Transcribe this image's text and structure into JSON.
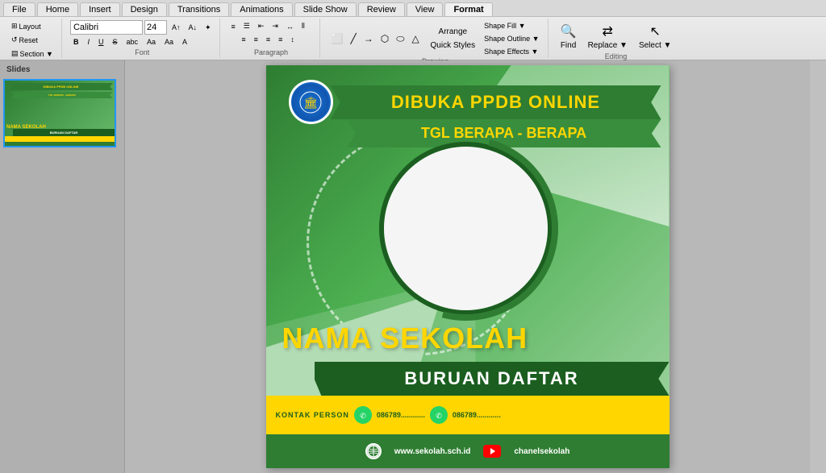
{
  "ribbon": {
    "tabs": [
      "File",
      "Home",
      "Insert",
      "Design",
      "Transitions",
      "Animations",
      "Slide Show",
      "Review",
      "View",
      "Format"
    ],
    "active_tab": "Format",
    "groups": {
      "slides": {
        "label": "Slides",
        "layout_label": "Layout",
        "reset_label": "Reset",
        "section_label": "Section ▼"
      },
      "font": {
        "label": "Font",
        "font_name": "Calibri",
        "font_size": "24",
        "bold": "B",
        "italic": "I",
        "underline": "U",
        "strikethrough": "S",
        "increase_font": "A↑",
        "decrease_font": "A↓",
        "clear_format": "✦"
      },
      "paragraph": {
        "label": "Paragraph"
      },
      "drawing": {
        "label": "Drawing",
        "arrange_label": "Arrange",
        "quick_styles_label": "Quick Styles",
        "shape_fill_label": "Shape Fill ▼",
        "shape_outline_label": "Shape Outline ▼",
        "shape_effects_label": "Shape Effects ▼"
      },
      "editing": {
        "label": "Editing",
        "find_label": "Find",
        "replace_label": "Replace ▼",
        "select_label": "Select ▼"
      }
    }
  },
  "poster": {
    "ppdb_text": "DIBUKA PPDB ONLINE",
    "tgl_text": "TGL BERAPA - BERAPA",
    "school_name": "NAMA SEKOLAH",
    "buruan_text": "BURUAN DAFTAR",
    "kontak_label": "KONTAK PERSON",
    "phone1": "086789............",
    "phone2": "086789............",
    "website": "www.sekolah.sch.id",
    "channel": "chanelsekolah",
    "logo_icon": "🏛"
  },
  "slides_panel": {
    "label": "Slides"
  }
}
